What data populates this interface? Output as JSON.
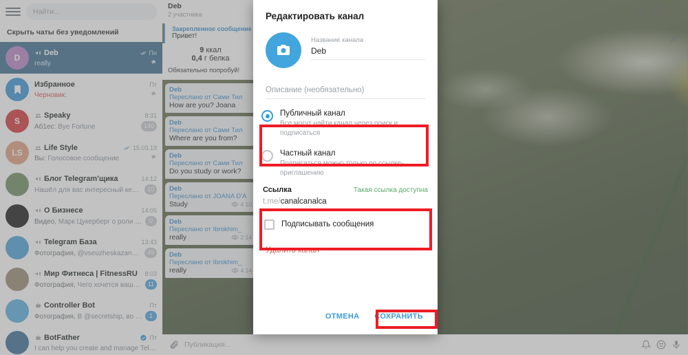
{
  "sidebar": {
    "search": {
      "placeholder": "Найти...",
      "icon": "search-icon"
    },
    "hide_muted_label": "Скрыть чаты без уведомлений",
    "chats": [
      {
        "avatar_letter": "D",
        "avatar_color": "#b887c9",
        "title": "Deb",
        "time": "Пн",
        "message": "really",
        "prefix": "",
        "badge": "",
        "kind": "channel",
        "pinned": true,
        "read": true,
        "active": true
      },
      {
        "avatar_letter": "",
        "avatar_color": "#3a96d8",
        "title": "Избранное",
        "time": "Пт",
        "message": "Черновик:",
        "prefix": "",
        "badge": "",
        "kind": "saved",
        "pinned": true,
        "draft": true,
        "active": false
      },
      {
        "avatar_letter": "S",
        "avatar_color": "#d5373a",
        "title": "Speaky",
        "time": "8:31",
        "message": "Bye Fortune",
        "prefix": "Аб1ес:",
        "badge": "140",
        "kind": "group",
        "active": false
      },
      {
        "avatar_letter": "LS",
        "avatar_color": "#e0a080",
        "title": "Life Style",
        "time": "15.03.19",
        "message": "Голосовое сообщение",
        "prefix": "Вы:",
        "badge": "",
        "kind": "group",
        "pinned": true,
        "read": true,
        "active": false
      },
      {
        "avatar_letter": "",
        "avatar_color": "#6e8f63",
        "title": "Блог Telegram'щика",
        "time": "14:12",
        "message": "Нашёл для вас интересный кейс...",
        "prefix": "",
        "badge": "10",
        "kind": "channel",
        "active": false
      },
      {
        "avatar_letter": "",
        "avatar_color": "#1a1a1a",
        "title": "О Бизнесе",
        "time": "14:05",
        "message": "Марк Цукерберг о роли о...",
        "prefix": "Видео,",
        "badge": "0",
        "kind": "channel",
        "active": false
      },
      {
        "avatar_letter": "",
        "avatar_color": "#4ba3d8",
        "title": "Telegram База",
        "time": "13:43",
        "message": "@vseuzheskazano ...",
        "prefix": "Фотография,",
        "badge": "49",
        "kind": "channel",
        "active": false
      },
      {
        "avatar_letter": "",
        "avatar_color": "#9a8b72",
        "title": "Мир Фитнеса | FitnessRU",
        "time": "8:03",
        "message": "Чего хочется ваше...",
        "prefix": "Фотография,",
        "badge": "11",
        "kind": "channel",
        "active": false
      },
      {
        "avatar_letter": "",
        "avatar_color": "#58b0e0",
        "title": "Controller Bot",
        "time": "Пт",
        "message": "В @secretship, во вт...",
        "prefix": "Фотография,",
        "badge": "1",
        "kind": "bot",
        "active": false
      },
      {
        "avatar_letter": "",
        "avatar_color": "#3b6e96",
        "title": "BotFather",
        "time": "Пт",
        "message": "I can help you create and manage Tele...",
        "prefix": "",
        "badge": "",
        "kind": "bot",
        "verified": true,
        "active": false
      }
    ]
  },
  "chat_panel": {
    "title": "Deb",
    "subtitle": "2 участника",
    "pinned_label": "Закрепленное сообщение",
    "pinned_text": "Привет!",
    "nutrition": [
      {
        "value": "9",
        "unit": "ккал"
      },
      {
        "value": "0,4",
        "unit": "г белка"
      }
    ],
    "try_note": "Обязательно попробуй!",
    "messages": [
      {
        "name": "Deb",
        "forwarded": "Переслано от Сами Тил",
        "text": "How are you? Joana",
        "views": "",
        "time": ""
      },
      {
        "name": "Deb",
        "forwarded": "Переслано от Сами Тил",
        "text": "Where are you from?",
        "views": "",
        "time": ""
      },
      {
        "name": "Deb",
        "forwarded": "Переслано от Сами Тил",
        "text": "Do you study or work?",
        "views": "",
        "time": ""
      },
      {
        "name": "Deb",
        "forwarded": "Переслано от JOANA D'A",
        "text": "Study",
        "views": "4",
        "time": "10"
      },
      {
        "name": "Deb",
        "forwarded": "Переслано от Ibrokhim_",
        "text": "really",
        "views": "2",
        "time": "14"
      },
      {
        "name": "Deb",
        "forwarded": "Переслано от Ibrokhim_",
        "text": "really",
        "views": "4",
        "time": "14"
      }
    ]
  },
  "composer": {
    "placeholder": "Публикация...",
    "icons": [
      "attach-icon",
      "notification-icon",
      "emoji-icon",
      "microphone-icon"
    ]
  },
  "top_icons": [
    "search-icon",
    "panel-icon",
    "more-vertical-icon",
    "close-icon"
  ],
  "dialog": {
    "title": "Редактировать канал",
    "avatar_icon": "camera-icon",
    "name_label": "Название канала",
    "name_value": "Deb",
    "description_placeholder": "Описание (необязательно)",
    "options": [
      {
        "id": "public",
        "label": "Публичный канал",
        "sublabel": "Все могут найти канал через поиск и подписаться",
        "selected": true
      },
      {
        "id": "private",
        "label": "Частный канал",
        "sublabel": "Подписаться можно только по ссылке-приглашению",
        "selected": false
      }
    ],
    "link": {
      "label": "Ссылка",
      "status": "Такая ссылка доступна",
      "domain": "t.me/",
      "value": "canalcanalca"
    },
    "sign_messages": {
      "label": "Подписывать сообщения",
      "checked": false
    },
    "delete_label": "Удалить канал",
    "cancel_label": "ОТМЕНА",
    "save_label": "СОХРАНИТЬ"
  },
  "colors": {
    "accent": "#3b9ad4",
    "highlight": "#ee1c25",
    "success": "#5aa86a",
    "danger": "#c9625a",
    "active_chat": "#3c6e91"
  }
}
